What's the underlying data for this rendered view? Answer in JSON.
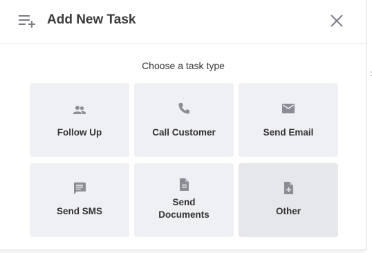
{
  "dialog": {
    "title": "Add New Task",
    "prompt": "Choose a task type"
  },
  "tasks": [
    {
      "label": "Follow Up",
      "icon": "people-icon"
    },
    {
      "label": "Call Customer",
      "icon": "phone-icon"
    },
    {
      "label": "Send Email",
      "icon": "envelope-icon"
    },
    {
      "label": "Send SMS",
      "icon": "message-icon"
    },
    {
      "label": "Send\nDocuments",
      "icon": "document-icon"
    },
    {
      "label": "Other",
      "icon": "add-document-icon"
    }
  ],
  "colors": {
    "tile_bg": "#eff0f3",
    "tile_hover": "#e6e7ea",
    "icon": "#8a8d93",
    "title": "#3a3a3a"
  }
}
